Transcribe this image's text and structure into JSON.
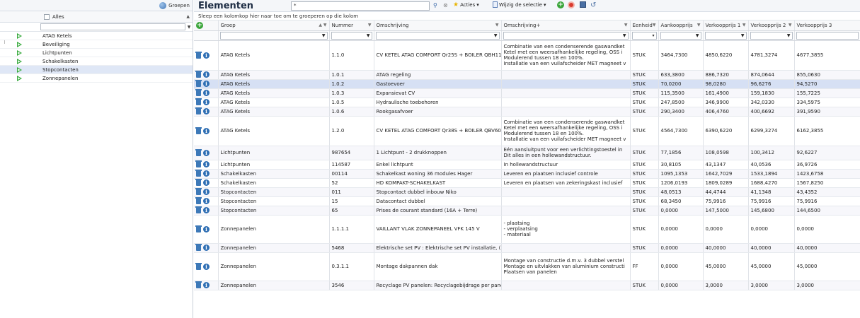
{
  "left_panel": {
    "group_button": "Groepen",
    "header_label": "Alles",
    "items": [
      {
        "label": "ATAG Ketels",
        "selected": false
      },
      {
        "label": "Beveiliging",
        "selected": false
      },
      {
        "label": "Lichtpunten",
        "selected": false
      },
      {
        "label": "Schakelkasten",
        "selected": false
      },
      {
        "label": "Stopcontacten",
        "selected": true
      },
      {
        "label": "Zonnepanelen",
        "selected": false
      }
    ]
  },
  "toolbar": {
    "title": "Elementen",
    "search_value": "*",
    "acties": "Acties",
    "wijzig": "Wijzig de selectie",
    "icons": [
      "search-icon",
      "clear-icon",
      "star-icon",
      "document-icon",
      "add-icon",
      "stop-icon",
      "save-icon",
      "undo-icon"
    ]
  },
  "group_hint": "Sleep een kolomkop hier naar toe om te groeperen op die kolom",
  "columns": [
    "Groep",
    "Nummer",
    "Omschrijving",
    "Omschrijving+",
    "Eenheid",
    "Aankoopprijs",
    "Verkoopprijs 1",
    "Verkoopprijs 2",
    "Verkoopprijs 3"
  ],
  "rows": [
    {
      "groep": "ATAG Ketels",
      "nummer": "1.1.0",
      "omschrijving": "CV KETEL ATAG COMFORT Qr25S + BOILER QBH11",
      "omschrijving_plus": "Combinatie van een condenserende gaswandket\nKetel met een weersafhankelijke regeling, OSS i\nModulerend tussen 18 en 100%.\nInstallatie van een vuilafscheider MET magneet v",
      "eenheid": "STUK",
      "aankoop": "3464,7300",
      "vk1": "4850,6220",
      "vk2": "4781,3274",
      "vk3": "4677,3855",
      "h": "h45",
      "sel": false
    },
    {
      "groep": "ATAG Ketels",
      "nummer": "1.0.1",
      "omschrijving": "ATAG regeling",
      "omschrijving_plus": "",
      "eenheid": "STUK",
      "aankoop": "633,3800",
      "vk1": "886,7320",
      "vk2": "874,0644",
      "vk3": "855,0630",
      "h": "h13",
      "sel": false
    },
    {
      "groep": "ATAG Ketels",
      "nummer": "1.0.2",
      "omschrijving": "Gastoevoer",
      "omschrijving_plus": "",
      "eenheid": "STUK",
      "aankoop": "70,0200",
      "vk1": "98,0280",
      "vk2": "96,6276",
      "vk3": "94,5270",
      "h": "h13",
      "sel": true
    },
    {
      "groep": "ATAG Ketels",
      "nummer": "1.0.3",
      "omschrijving": "Expansievat CV",
      "omschrijving_plus": "",
      "eenheid": "STUK",
      "aankoop": "115,3500",
      "vk1": "161,4900",
      "vk2": "159,1830",
      "vk3": "155,7225",
      "h": "h13",
      "sel": false
    },
    {
      "groep": "ATAG Ketels",
      "nummer": "1.0.5",
      "omschrijving": "Hydraulische toebehoren",
      "omschrijving_plus": "",
      "eenheid": "STUK",
      "aankoop": "247,8500",
      "vk1": "346,9900",
      "vk2": "342,0330",
      "vk3": "334,5975",
      "h": "h13",
      "sel": false
    },
    {
      "groep": "ATAG Ketels",
      "nummer": "1.0.6",
      "omschrijving": "Rookgasafvoer",
      "omschrijving_plus": "",
      "eenheid": "STUK",
      "aankoop": "290,3400",
      "vk1": "406,4760",
      "vk2": "400,6692",
      "vk3": "391,9590",
      "h": "h13",
      "sel": false
    },
    {
      "groep": "ATAG Ketels",
      "nummer": "1.2.0",
      "omschrijving": "CV KETEL ATAG COMFORT Qr38S + BOILER QBV60",
      "omschrijving_plus": "Combinatie van een condenserende gaswandket\nKetel met een weersafhankelijke regeling, OSS i\nModulerend tussen 18 en 100%.\nInstallatie van een vuilafscheider MET magneet v",
      "eenheid": "STUK",
      "aankoop": "4564,7300",
      "vk1": "6390,6220",
      "vk2": "6299,3274",
      "vk3": "6162,3855",
      "h": "h45",
      "sel": false
    },
    {
      "groep": "Lichtpunten",
      "nummer": "987654",
      "omschrijving": "1 Lichtpunt - 2 drukknoppen",
      "omschrijving_plus": "Eén aansluitpunt voor een verlichtingstoestel in\nDit alles in een hollewandstructuur.",
      "eenheid": "STUK",
      "aankoop": "77,1856",
      "vk1": "108,0598",
      "vk2": "100,3412",
      "vk3": "92,6227",
      "h": "h24",
      "sel": false
    },
    {
      "groep": "Lichtpunten",
      "nummer": "114587",
      "omschrijving": "Enkel lichtpunt",
      "omschrijving_plus": "In hollewandstructuur",
      "eenheid": "STUK",
      "aankoop": "30,8105",
      "vk1": "43,1347",
      "vk2": "40,0536",
      "vk3": "36,9726",
      "h": "h13",
      "sel": false
    },
    {
      "groep": "Schakelkasten",
      "nummer": "00114",
      "omschrijving": "Schakelkast woning 36 modules Hager",
      "omschrijving_plus": "Leveren en plaatsen inclusief controle",
      "eenheid": "STUK",
      "aankoop": "1095,1353",
      "vk1": "1642,7029",
      "vk2": "1533,1894",
      "vk3": "1423,6758",
      "h": "h13",
      "sel": false
    },
    {
      "groep": "Schakelkasten",
      "nummer": "52",
      "omschrijving": "HD KOMPAKT-SCHAKELKAST",
      "omschrijving_plus": "Leveren en plaatsen van zekeringskast inclusief",
      "eenheid": "STUK",
      "aankoop": "1206,0193",
      "vk1": "1809,0289",
      "vk2": "1688,4270",
      "vk3": "1567,8250",
      "h": "h13",
      "sel": false
    },
    {
      "groep": "Stopcontacten",
      "nummer": "011",
      "omschrijving": "Stopcontact dubbel inbouw Niko",
      "omschrijving_plus": "",
      "eenheid": "STUK",
      "aankoop": "48,0513",
      "vk1": "44,4744",
      "vk2": "41,1348",
      "vk3": "43,4352",
      "h": "h13",
      "sel": false
    },
    {
      "groep": "Stopcontacten",
      "nummer": "15",
      "omschrijving": "Datacontact dubbel",
      "omschrijving_plus": "",
      "eenheid": "STUK",
      "aankoop": "68,3450",
      "vk1": "75,9916",
      "vk2": "75,9916",
      "vk3": "75,9916",
      "h": "h13",
      "sel": false
    },
    {
      "groep": "Stopcontacten",
      "nummer": "65",
      "omschrijving": "Prises de courant standard (16A + Terre)",
      "omschrijving_plus": "",
      "eenheid": "STUK",
      "aankoop": "0,0000",
      "vk1": "147,5000",
      "vk2": "145,6800",
      "vk3": "144,6500",
      "h": "h13",
      "sel": false
    },
    {
      "groep": "Zonnepanelen",
      "nummer": "1.1.1.1",
      "omschrijving": "VAILLANT VLAK ZONNEPANEEL VFK 145 V",
      "omschrijving_plus": "- plaatsing\n- verplaatsing\n- materiaal",
      "eenheid": "STUK",
      "aankoop": "0,0000",
      "vk1": "0,0000",
      "vk2": "0,0000",
      "vk3": "0,0000",
      "h": "h38",
      "sel": false
    },
    {
      "groep": "Zonnepanelen",
      "nummer": "5468",
      "omschrijving": "Elektrische set PV : Elektrische set PV installatie, (",
      "omschrijving_plus": "",
      "eenheid": "STUK",
      "aankoop": "0,0000",
      "vk1": "40,0000",
      "vk2": "40,0000",
      "vk3": "40,0000",
      "h": "h13",
      "sel": false
    },
    {
      "groep": "Zonnepanelen",
      "nummer": "0.3.1.1",
      "omschrijving": "Montage dakpannen dak",
      "omschrijving_plus": "Montage van constructie d.m.v. 3 dubbel verstel\nMontage en uitvlakken van aluminium constructi\nPlaatsen van panelen",
      "eenheid": "FF",
      "aankoop": "0,0000",
      "vk1": "45,0000",
      "vk2": "45,0000",
      "vk3": "45,0000",
      "h": "h38",
      "sel": false
    },
    {
      "groep": "Zonnepanelen",
      "nummer": "3546",
      "omschrijving": "Recyclage PV panelen: Recyclagebijdrage per pane",
      "omschrijving_plus": "",
      "eenheid": "STUK",
      "aankoop": "0,0000",
      "vk1": "3,0000",
      "vk2": "3,0000",
      "vk3": "3,0000",
      "h": "h13",
      "sel": false
    }
  ]
}
